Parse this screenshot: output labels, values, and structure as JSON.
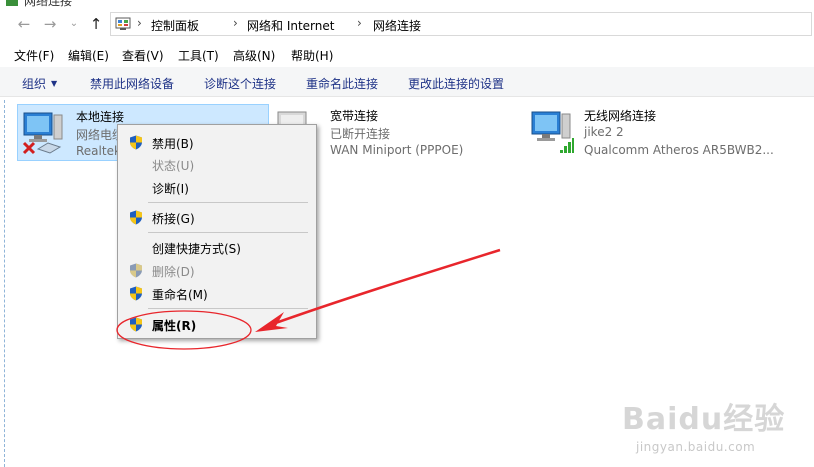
{
  "window": {
    "title": "网络连接"
  },
  "address": {
    "crumbs": [
      "控制面板",
      "网络和 Internet",
      "网络连接"
    ],
    "separator": "›"
  },
  "nav": {
    "back": "←",
    "forward": "→",
    "recent": "⌄",
    "up": "↑"
  },
  "menubar": {
    "items": [
      "文件(F)",
      "编辑(E)",
      "查看(V)",
      "工具(T)",
      "高级(N)",
      "帮助(H)"
    ]
  },
  "toolbar": {
    "organize": "组织",
    "disable": "禁用此网络设备",
    "diagnose": "诊断这个连接",
    "rename": "重命名此连接",
    "change": "更改此连接的设置"
  },
  "connections": [
    {
      "name": "本地连接",
      "status": "网络电缆",
      "device": "Realtek",
      "state": "disconnected"
    },
    {
      "name": "宽带连接",
      "status": "已断开连接",
      "device": "WAN Miniport (PPPOE)",
      "state": "disconnected"
    },
    {
      "name": "无线网络连接",
      "status": "jike2  2",
      "device": "Qualcomm Atheros AR5BWB2...",
      "state": "connected"
    }
  ],
  "context_menu": {
    "items": [
      {
        "label": "禁用(B)",
        "shield": true,
        "disabled": false,
        "bold": false
      },
      {
        "label": "状态(U)",
        "shield": false,
        "disabled": true,
        "bold": false
      },
      {
        "label": "诊断(I)",
        "shield": false,
        "disabled": false,
        "bold": false
      },
      {
        "label": "桥接(G)",
        "shield": true,
        "disabled": false,
        "bold": false
      },
      {
        "label": "创建快捷方式(S)",
        "shield": false,
        "disabled": false,
        "bold": false
      },
      {
        "label": "删除(D)",
        "shield": true,
        "disabled": true,
        "bold": false
      },
      {
        "label": "重命名(M)",
        "shield": true,
        "disabled": false,
        "bold": false
      },
      {
        "label": "属性(R)",
        "shield": true,
        "disabled": false,
        "bold": true
      }
    ]
  },
  "annotation": {
    "color": "#e8262c"
  },
  "watermark": {
    "logo": "Baidu经验",
    "url": "jingyan.baidu.com"
  },
  "colors": {
    "accent": "#1e3287",
    "selection": "#cde8ff",
    "toolbar_bg": "#f5f6f7",
    "menu_bg": "#f2f2f2"
  }
}
